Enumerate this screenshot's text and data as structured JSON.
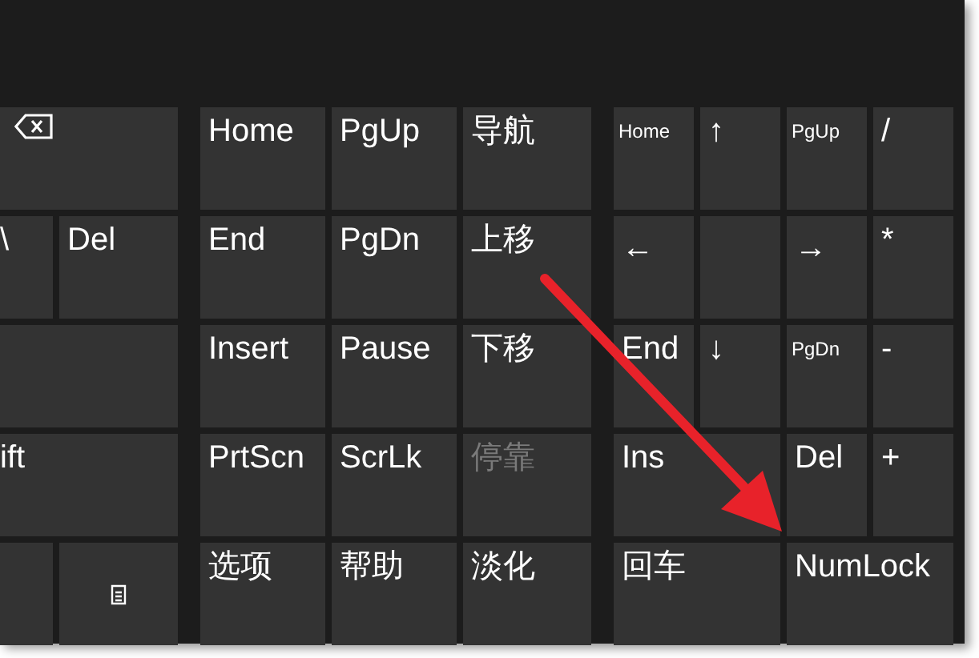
{
  "keyboard": {
    "main_keys": [
      {
        "kind": "backspace"
      },
      {
        "kind": "cut",
        "label": "\\"
      },
      {
        "kind": "key",
        "label": "Del"
      },
      {
        "kind": "wide_blank"
      },
      {
        "kind": "cut_wide",
        "label": "ift"
      },
      {
        "kind": "blank"
      },
      {
        "kind": "menu"
      }
    ],
    "control_keys": [
      {
        "label": "Home"
      },
      {
        "label": "PgUp"
      },
      {
        "label": "导航",
        "disabled": false
      },
      {
        "label": "End"
      },
      {
        "label": "PgDn"
      },
      {
        "label": "上移",
        "disabled": false
      },
      {
        "label": "Insert"
      },
      {
        "label": "Pause"
      },
      {
        "label": "下移",
        "disabled": false
      },
      {
        "label": "PrtScn"
      },
      {
        "label": "ScrLk"
      },
      {
        "label": "停靠",
        "disabled": true
      },
      {
        "label": "选项"
      },
      {
        "label": "帮助"
      },
      {
        "label": "淡化",
        "disabled": false
      }
    ],
    "numpad_keys": [
      {
        "kind": "small",
        "label": "Home"
      },
      {
        "kind": "key",
        "label": "↑"
      },
      {
        "kind": "small",
        "label": "PgUp"
      },
      {
        "kind": "key",
        "label": "/"
      },
      {
        "kind": "arrow",
        "label": "←"
      },
      {
        "kind": "blank"
      },
      {
        "kind": "arrow",
        "label": "→"
      },
      {
        "kind": "key",
        "label": "*"
      },
      {
        "kind": "key",
        "label": "End"
      },
      {
        "kind": "key",
        "label": "↓"
      },
      {
        "kind": "small",
        "label": "PgDn"
      },
      {
        "kind": "key",
        "label": "-"
      },
      {
        "kind": "wide",
        "label": "Ins"
      },
      {
        "kind": "key",
        "label": "Del"
      },
      {
        "kind": "key",
        "label": "+"
      },
      {
        "kind": "wide",
        "label": "回车"
      },
      {
        "kind": "wide",
        "label": "NumLock"
      }
    ]
  }
}
